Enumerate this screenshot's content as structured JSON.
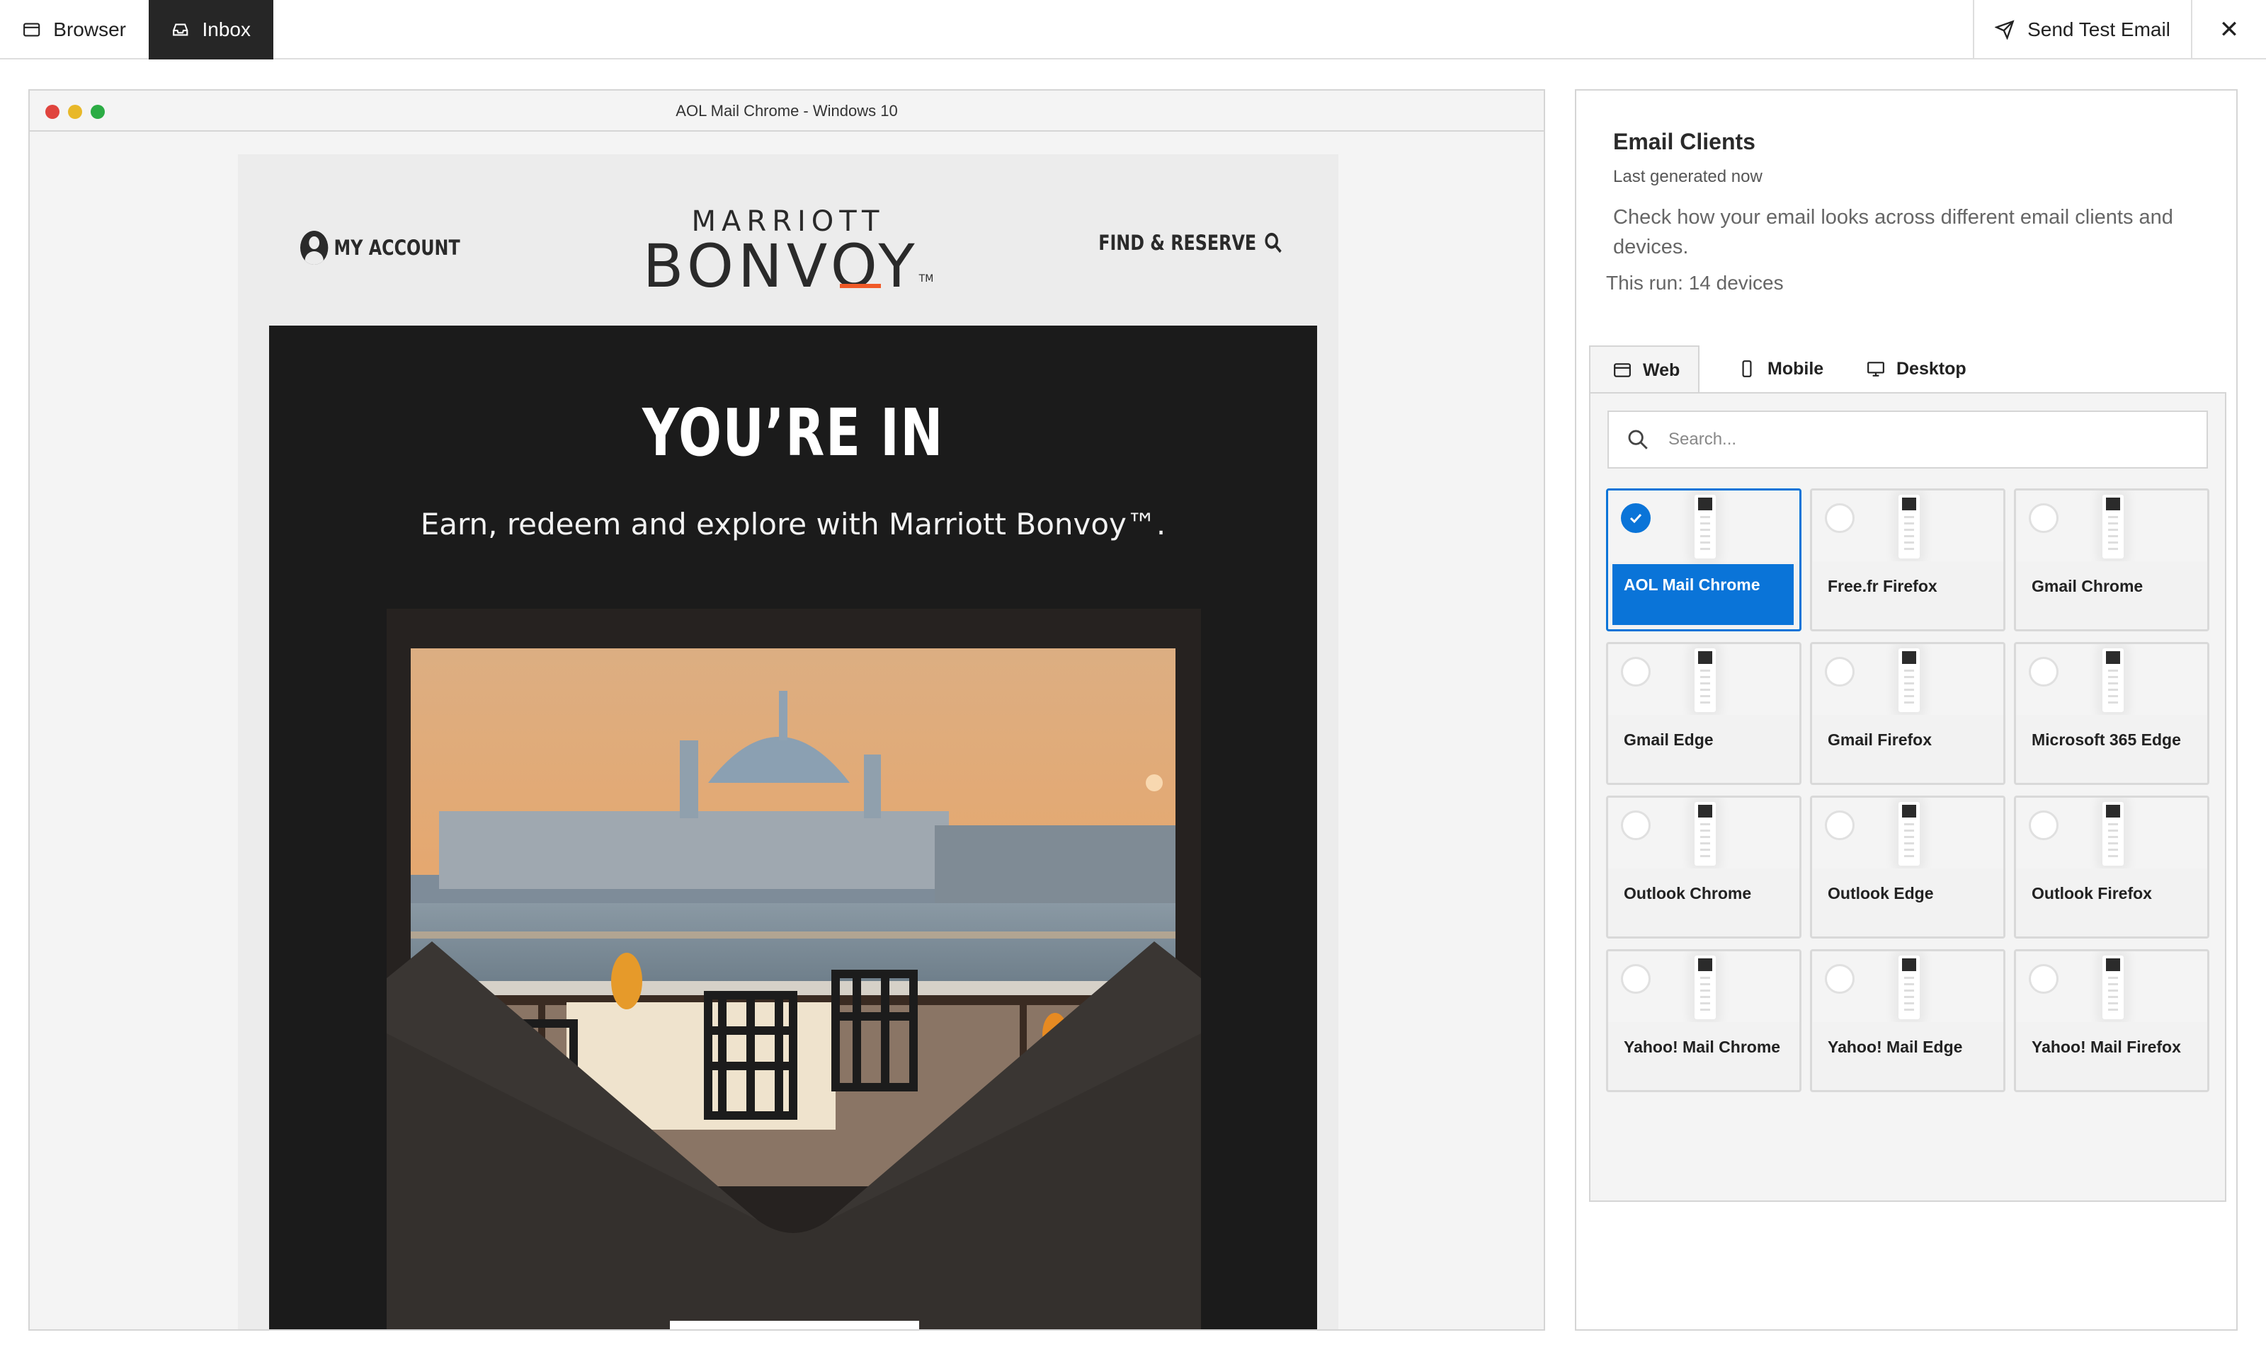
{
  "topbar": {
    "tabs": [
      {
        "label": "Browser",
        "icon": "browser-window-icon"
      },
      {
        "label": "Inbox",
        "icon": "inbox-tray-icon",
        "active": true
      }
    ],
    "send_label": "Send Test Email",
    "send_icon": "paper-plane-icon",
    "close_glyph": "✕"
  },
  "preview": {
    "window_title": "AOL Mail Chrome - Windows 10",
    "email": {
      "my_account": "MY ACCOUNT",
      "brand_top": "MARRIOTT",
      "brand_main": "BONVOY",
      "brand_tm": "TM",
      "find_reserve": "FIND & RESERVE",
      "hero_title": "YOU’RE IN",
      "hero_subtitle": "Earn, redeem and explore with Marriott Bonvoy™."
    }
  },
  "panel": {
    "title": "Email Clients",
    "generated": "Last generated now",
    "description": "Check how your email looks across different email clients and devices.",
    "run": "This run: 14 devices",
    "tabs": [
      {
        "label": "Web",
        "icon": "browser-window-icon",
        "active": true
      },
      {
        "label": "Mobile",
        "icon": "phone-icon"
      },
      {
        "label": "Desktop",
        "icon": "monitor-icon"
      }
    ],
    "search_placeholder": "Search...",
    "clients": [
      {
        "name": "AOL Mail Chrome",
        "selected": true
      },
      {
        "name": "Free.fr Firefox",
        "selected": false
      },
      {
        "name": "Gmail Chrome",
        "selected": false
      },
      {
        "name": "Gmail Edge",
        "selected": false
      },
      {
        "name": "Gmail Firefox",
        "selected": false
      },
      {
        "name": "Microsoft 365 Edge",
        "selected": false
      },
      {
        "name": "Outlook Chrome",
        "selected": false
      },
      {
        "name": "Outlook Edge",
        "selected": false
      },
      {
        "name": "Outlook Firefox",
        "selected": false
      },
      {
        "name": "Yahoo! Mail Chrome",
        "selected": false
      },
      {
        "name": "Yahoo! Mail Edge",
        "selected": false
      },
      {
        "name": "Yahoo! Mail Firefox",
        "selected": false
      }
    ]
  },
  "colors": {
    "accent": "#0a74d8",
    "dark_tab": "#262626",
    "brand_orange": "#f05a28",
    "hero_bg": "#1b1b1b"
  }
}
